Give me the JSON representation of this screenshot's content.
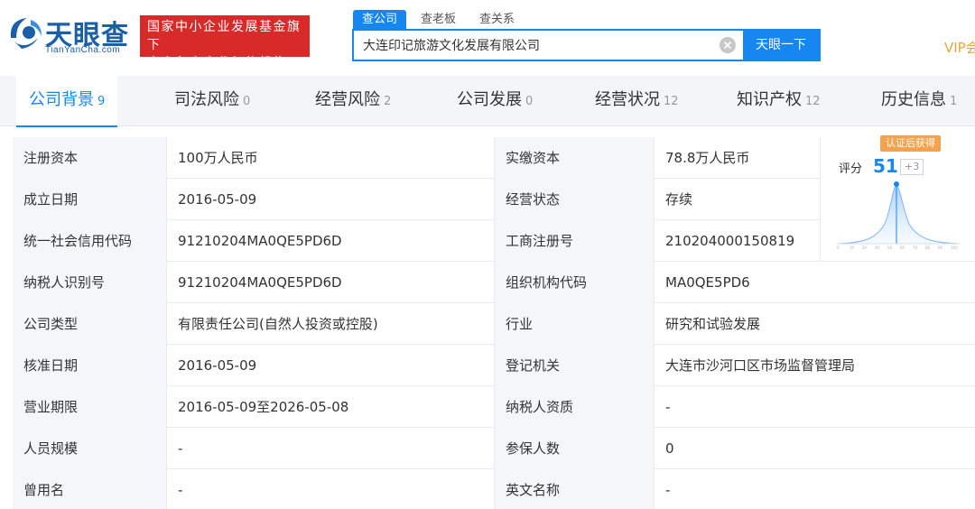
{
  "header": {
    "logo_text": "天眼查",
    "logo_sub": "TianYanCha.com",
    "slogan_line1": "国家中小企业发展基金旗下",
    "slogan_line2": "官方备案企业征信机构",
    "search_tabs": [
      "查公司",
      "查老板",
      "查关系"
    ],
    "search_value": "大连印记旅游文化发展有限公司",
    "search_button": "天眼一下",
    "vip": "VIP会"
  },
  "nav": [
    {
      "label": "公司背景",
      "count": "9"
    },
    {
      "label": "司法风险",
      "count": "0"
    },
    {
      "label": "经营风险",
      "count": "2"
    },
    {
      "label": "公司发展",
      "count": "0"
    },
    {
      "label": "经营状况",
      "count": "12"
    },
    {
      "label": "知识产权",
      "count": "12"
    },
    {
      "label": "历史信息",
      "count": "1"
    }
  ],
  "rows": [
    {
      "l1": "注册资本",
      "v1": "100万人民币",
      "l2": "实缴资本",
      "v2": "78.8万人民币"
    },
    {
      "l1": "成立日期",
      "v1": "2016-05-09",
      "l2": "经营状态",
      "v2": "存续"
    },
    {
      "l1": "统一社会信用代码",
      "v1": "91210204MA0QE5PD6D",
      "l2": "工商注册号",
      "v2": "210204000150819"
    },
    {
      "l1": "纳税人识别号",
      "v1": "91210204MA0QE5PD6D",
      "l2": "组织机构代码",
      "v2": "MA0QE5PD6"
    },
    {
      "l1": "公司类型",
      "v1": "有限责任公司(自然人投资或控股)",
      "l2": "行业",
      "v2": "研究和试验发展"
    },
    {
      "l1": "核准日期",
      "v1": "2016-05-09",
      "l2": "登记机关",
      "v2": "大连市沙河口区市场监督管理局"
    },
    {
      "l1": "营业期限",
      "v1": "2016-05-09至2026-05-08",
      "l2": "纳税人资质",
      "v2": "-"
    },
    {
      "l1": "人员规模",
      "v1": "-",
      "l2": "参保人数",
      "v2": "0"
    },
    {
      "l1": "曾用名",
      "v1": "-",
      "l2": "英文名称",
      "v2": "-"
    }
  ],
  "score": {
    "badge": "认证后获得",
    "label": "评分",
    "value": "51",
    "plus": "+3"
  },
  "colors": {
    "brand": "#1687f0",
    "slogan_bg": "#d92a2a",
    "badge": "#f5a24c",
    "vip": "#e2a73c"
  }
}
